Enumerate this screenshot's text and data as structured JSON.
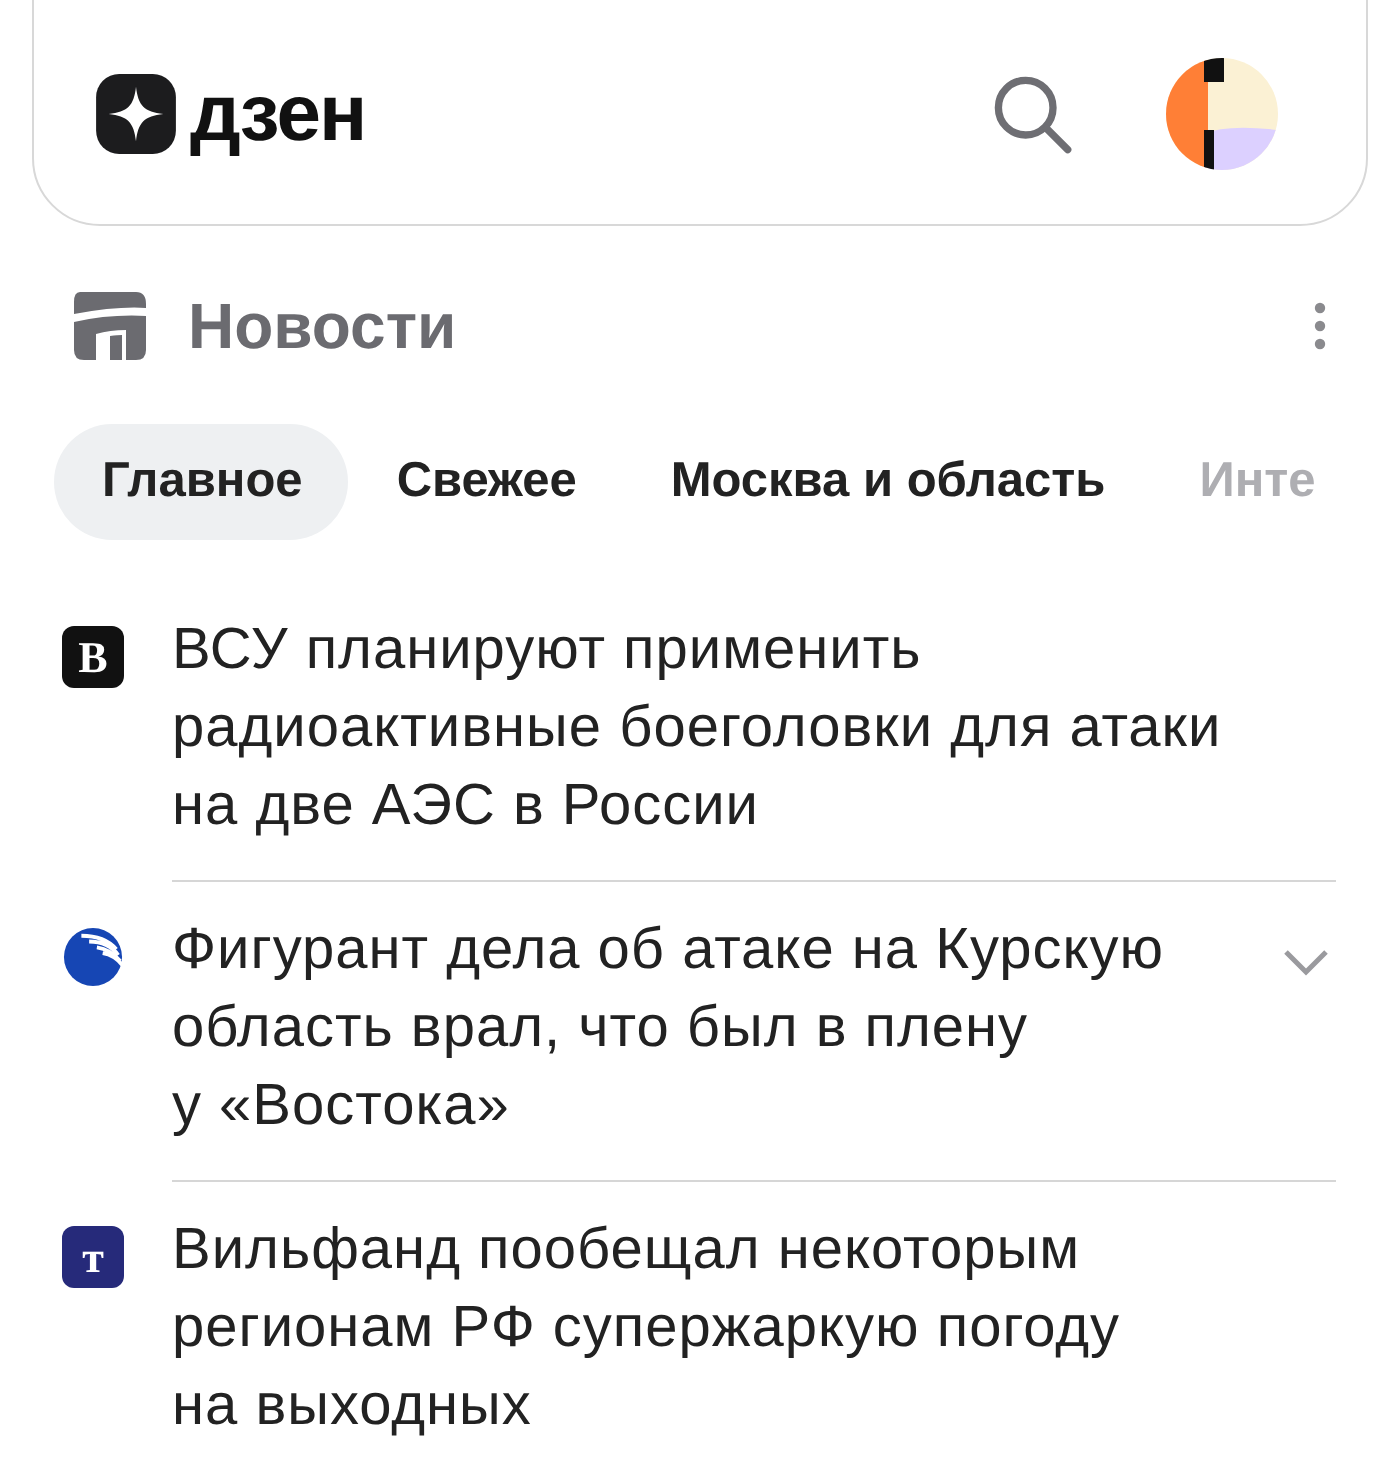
{
  "header": {
    "logo_text": "дзен"
  },
  "section": {
    "title": "Новости"
  },
  "tabs": [
    {
      "label": "Главное",
      "selected": true
    },
    {
      "label": "Свежее",
      "selected": false
    },
    {
      "label": "Москва и область",
      "selected": false
    },
    {
      "label": "Инте",
      "selected": false,
      "faded": true
    }
  ],
  "news": [
    {
      "source_icon": {
        "kind": "letter",
        "letter": "B",
        "color": "#111111"
      },
      "headline": "ВСУ планируют применить радиоактивные боеголовки для атаки на две АЭС в России",
      "expandable": false
    },
    {
      "source_icon": {
        "kind": "globe",
        "color": "#1646b4"
      },
      "headline": "Фигурант дела об атаке на Курскую область врал, что был в плену у «Востока»",
      "expandable": true
    },
    {
      "source_icon": {
        "kind": "letter",
        "letter": "т",
        "color": "#262a7a"
      },
      "headline": "Вильфанд пообещал некоторым регионам РФ супержаркую погоду на выходных",
      "expandable": false
    }
  ]
}
